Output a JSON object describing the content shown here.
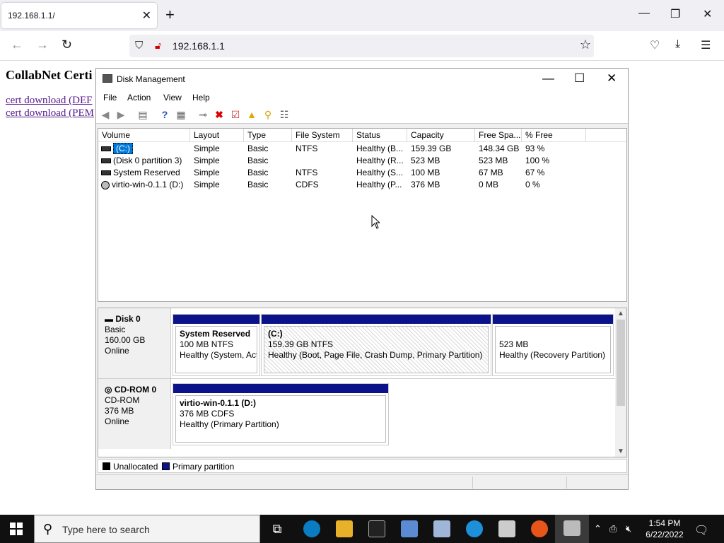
{
  "browser": {
    "tab_title": "192.168.1.1/",
    "url": "192.168.1.1"
  },
  "page": {
    "heading": "CollabNet Certi",
    "links": [
      "cert download (DEF",
      "cert download (PEM"
    ]
  },
  "window": {
    "title": "Disk Management",
    "menu": [
      "File",
      "Action",
      "View",
      "Help"
    ]
  },
  "volumes": {
    "columns": [
      "Volume",
      "Layout",
      "Type",
      "File System",
      "Status",
      "Capacity",
      "Free Spa...",
      "% Free"
    ],
    "rows": [
      [
        "(C:)",
        "Simple",
        "Basic",
        "NTFS",
        "Healthy (B...",
        "159.39 GB",
        "148.34 GB",
        "93 %"
      ],
      [
        "(Disk 0 partition 3)",
        "Simple",
        "Basic",
        "",
        "Healthy (R...",
        "523 MB",
        "523 MB",
        "100 %"
      ],
      [
        "System Reserved",
        "Simple",
        "Basic",
        "NTFS",
        "Healthy (S...",
        "100 MB",
        "67 MB",
        "67 %"
      ],
      [
        "virtio-win-0.1.1 (D:)",
        "Simple",
        "Basic",
        "CDFS",
        "Healthy (P...",
        "376 MB",
        "0 MB",
        "0 %"
      ]
    ]
  },
  "disks": [
    {
      "name": "Disk 0",
      "type": "Basic",
      "size": "160.00 GB",
      "state": "Online",
      "partitions": [
        {
          "title": "System Reserved",
          "line1": "100 MB NTFS",
          "line2": "Healthy (System, Act"
        },
        {
          "title": "(C:)",
          "line1": "159.39 GB NTFS",
          "line2": "Healthy (Boot, Page File, Crash Dump, Primary Partition)"
        },
        {
          "title": "",
          "line1": "523 MB",
          "line2": "Healthy (Recovery Partition)"
        }
      ]
    },
    {
      "name": "CD-ROM 0",
      "type": "CD-ROM",
      "size": "376 MB",
      "state": "Online",
      "partitions": [
        {
          "title": "virtio-win-0.1.1  (D:)",
          "line1": "376 MB CDFS",
          "line2": "Healthy (Primary Partition)"
        }
      ]
    }
  ],
  "legend": {
    "unallocated": "Unallocated",
    "primary": "Primary partition",
    "unallocated_color": "#000000",
    "primary_color": "#0c138a"
  },
  "taskbar": {
    "search_placeholder": "Type here to search",
    "time": "1:54 PM",
    "date": "6/22/2022"
  }
}
